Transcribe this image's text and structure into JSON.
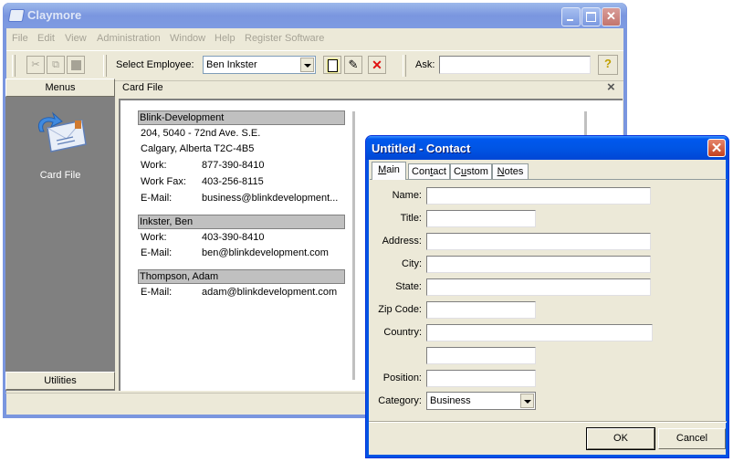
{
  "main_window": {
    "title": "Claymore",
    "menu": [
      "File",
      "Edit",
      "View",
      "Administration",
      "Window",
      "Help",
      "Register Software"
    ],
    "toolbar": {
      "cut_icon": "scissors-icon",
      "copy_icon": "copy-icon",
      "paste_icon": "paste-icon",
      "select_employee_label": "Select Employee:",
      "select_employee_value": "Ben Inkster",
      "new_icon": "new-document-icon",
      "edit_icon": "edit-document-icon",
      "delete_icon": "delete-x-icon",
      "ask_label": "Ask:",
      "ask_value": "",
      "help_icon": "help-book-icon"
    },
    "left_pane": {
      "header": "Menus",
      "items": [
        {
          "label": "Card File",
          "icon": "card-file-icon"
        }
      ],
      "footer": "Utilities"
    },
    "card_file": {
      "title": "Card File",
      "close_glyph": "×",
      "groups": [
        {
          "name": "Blink-Development",
          "lines": [
            "204, 5040 - 72nd Ave. S.E.",
            "Calgary, Alberta T2C-4B5"
          ],
          "fields": [
            {
              "label": "Work:",
              "value": "877-390-8410"
            },
            {
              "label": "Work Fax:",
              "value": "403-256-8115"
            },
            {
              "label": "E-Mail:",
              "value": "business@blinkdevelopment..."
            }
          ]
        },
        {
          "name": "Inkster, Ben",
          "fields": [
            {
              "label": "Work:",
              "value": "403-390-8410"
            },
            {
              "label": "E-Mail:",
              "value": "ben@blinkdevelopment.com"
            }
          ]
        },
        {
          "name": "Thompson, Adam",
          "fields": [
            {
              "label": "E-Mail:",
              "value": "adam@blinkdevelopment.com"
            }
          ]
        }
      ]
    }
  },
  "dialog": {
    "title": "Untitled - Contact",
    "close_glyph": "✕",
    "tabs": [
      {
        "label": "Main",
        "mnemonic": "M",
        "active": true
      },
      {
        "label": "Contact",
        "mnemonic": "t",
        "active": false
      },
      {
        "label": "Custom",
        "mnemonic": "u",
        "active": false
      },
      {
        "label": "Notes",
        "mnemonic": "N",
        "active": false
      }
    ],
    "fields": {
      "name": {
        "label": "Name:",
        "value": ""
      },
      "title": {
        "label": "Title:",
        "value": ""
      },
      "address": {
        "label": "Address:",
        "value": ""
      },
      "city": {
        "label": "City:",
        "value": ""
      },
      "state": {
        "label": "State:",
        "value": ""
      },
      "zip": {
        "label": "Zip Code:",
        "value": ""
      },
      "country": {
        "label": "Country:",
        "value": ""
      },
      "extra": {
        "label": "",
        "value": ""
      },
      "position": {
        "label": "Position:",
        "value": ""
      },
      "category": {
        "label": "Category:",
        "value": "Business"
      }
    },
    "ok_label": "OK",
    "cancel_label": "Cancel"
  }
}
